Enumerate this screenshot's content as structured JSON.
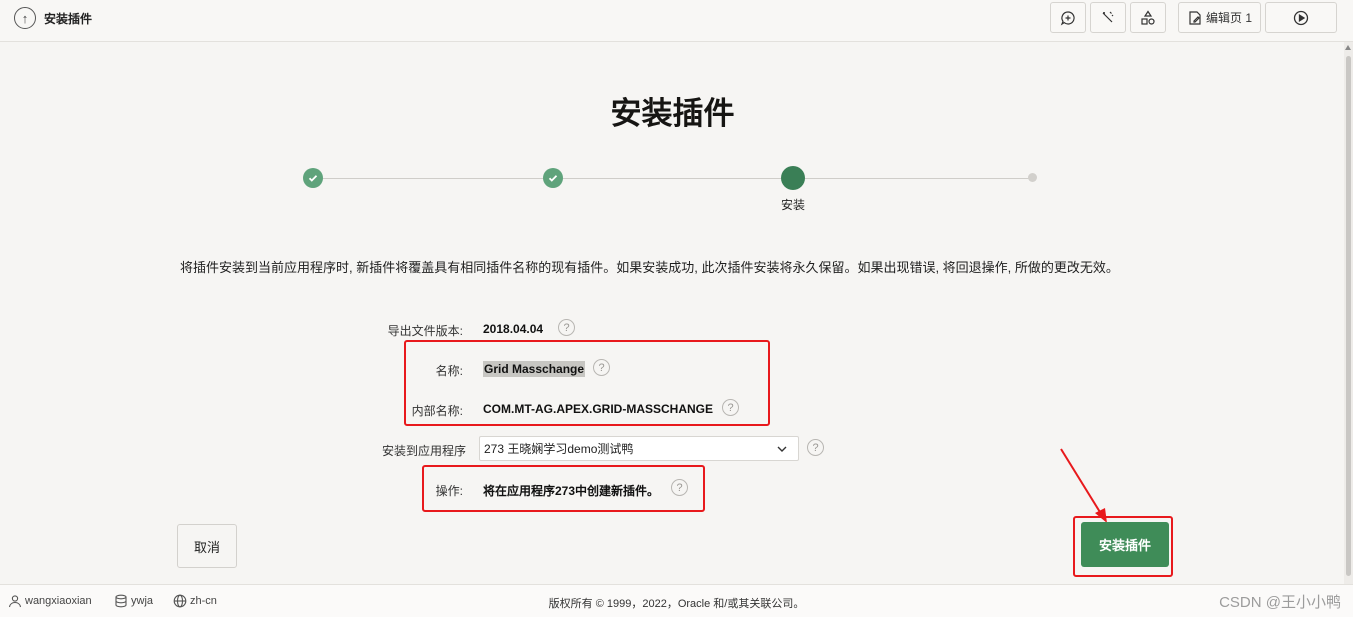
{
  "topbar": {
    "title": "安装插件",
    "edit_page_label": "编辑页 1"
  },
  "page": {
    "title": "安装插件"
  },
  "wizard": {
    "current_step_label": "安装"
  },
  "description": "将插件安装到当前应用程序时, 新插件将覆盖具有相同插件名称的现有插件。如果安装成功, 此次插件安装将永久保留。如果出现错误, 将回退操作, 所做的更改无效。",
  "form": {
    "export_version_label": "导出文件版本:",
    "export_version_value": "2018.04.04",
    "name_label": "名称:",
    "name_value": "Grid Masschange",
    "internal_name_label": "内部名称:",
    "internal_name_value": "COM.MT-AG.APEX.GRID-MASSCHANGE",
    "install_to_app_label": "安装到应用程序",
    "install_to_app_value": "273 王晓娴学习demo测试鸭",
    "action_label": "操作:",
    "action_value": "将在应用程序273中创建新插件。",
    "help_glyph": "?"
  },
  "buttons": {
    "cancel": "取消",
    "install": "安装插件"
  },
  "footer": {
    "user": "wangxiaoxian",
    "workspace": "ywja",
    "language": "zh-cn",
    "copyright": "版权所有 © 1999，2022，Oracle 和/或其关联公司。",
    "watermark": "CSDN @王小小鸭"
  },
  "colors": {
    "primary_green": "#3f8c58",
    "step_done": "#5fa37b",
    "annotation_red": "#e8191c"
  }
}
